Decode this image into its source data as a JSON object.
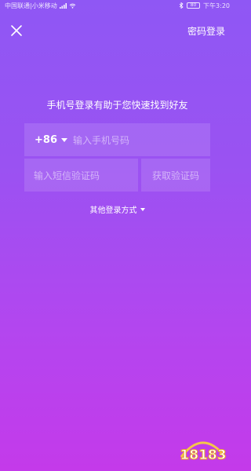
{
  "status_bar": {
    "carrier": "中国联通|小米移动",
    "battery": "80",
    "time": "下午3:20"
  },
  "header": {
    "close_icon": "close-icon",
    "password_login": "密码登录"
  },
  "main": {
    "hint": "手机号登录有助于您快速找到好友",
    "country_code": "+86",
    "phone_placeholder": "输入手机号码",
    "code_placeholder": "输入短信验证码",
    "get_code": "获取验证码",
    "other_login": "其他登录方式"
  },
  "watermark": {
    "text": "18183"
  },
  "colors": {
    "gradient_top": "#8f57f4",
    "gradient_bottom": "#c43aea"
  }
}
